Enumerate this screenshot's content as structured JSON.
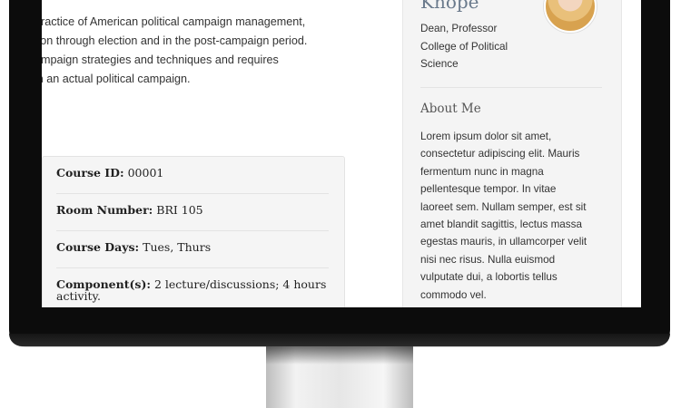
{
  "description": {
    "lines": [
      "practice of American political campaign management,",
      "tion through election and in the post-campaign period.",
      "ampaign strategies and techniques and requires",
      "in an actual political campaign."
    ]
  },
  "course": {
    "id_label": "Course ID:",
    "id_value": "00001",
    "room_label": "Room Number:",
    "room_value": "BRI 105",
    "days_label": "Course Days:",
    "days_value": "Tues, Thurs",
    "components_label": "Component(s):",
    "components_value": "2 lecture/discussions; 4 hours",
    "components_value_2": "activity."
  },
  "profile": {
    "name": "Knope",
    "title_line1": "Dean, Professor",
    "title_line2": "College of Political",
    "title_line3": "Science",
    "about_heading": "About Me",
    "bio_lines": [
      "Lorem ipsum dolor sit amet,",
      "consectetur adipiscing elit. Mauris",
      "fermentum nunc in magna",
      "pellentesque tempor. In vitae",
      "laoreet sem. Nullam semper, est sit",
      "amet blandit sagittis, lectus massa",
      "egestas mauris, in ullamcorper velit",
      "nisi nec risus. Nulla euismod",
      "vulputate dui, a lobortis tellus",
      "commodo vel."
    ]
  }
}
